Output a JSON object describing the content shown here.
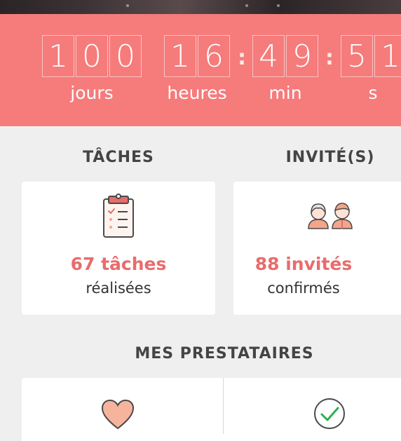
{
  "countdown": {
    "days": [
      "1",
      "0",
      "0"
    ],
    "hours": [
      "1",
      "6"
    ],
    "minutes": [
      "4",
      "9"
    ],
    "seconds": [
      "5",
      "1"
    ],
    "separator": ":",
    "labels": {
      "days": "jours",
      "hours": "heures",
      "minutes": "min",
      "seconds": "s"
    }
  },
  "tasks": {
    "title": "TÂCHES",
    "count": "67 tâches",
    "status": "réalisées",
    "icon": "clipboard-checklist-icon"
  },
  "guests": {
    "title": "INVITÉ(S)",
    "count": "88 invités",
    "status": "confirmés",
    "icon": "couple-icon"
  },
  "providers": {
    "title": "MES PRESTATAIRES",
    "items": [
      {
        "icon": "heart-icon"
      },
      {
        "icon": "check-circle-icon"
      }
    ]
  },
  "colors": {
    "countdown_bg": "#f67b7b",
    "accent": "#e96c6c",
    "check": "#2bb24c"
  }
}
